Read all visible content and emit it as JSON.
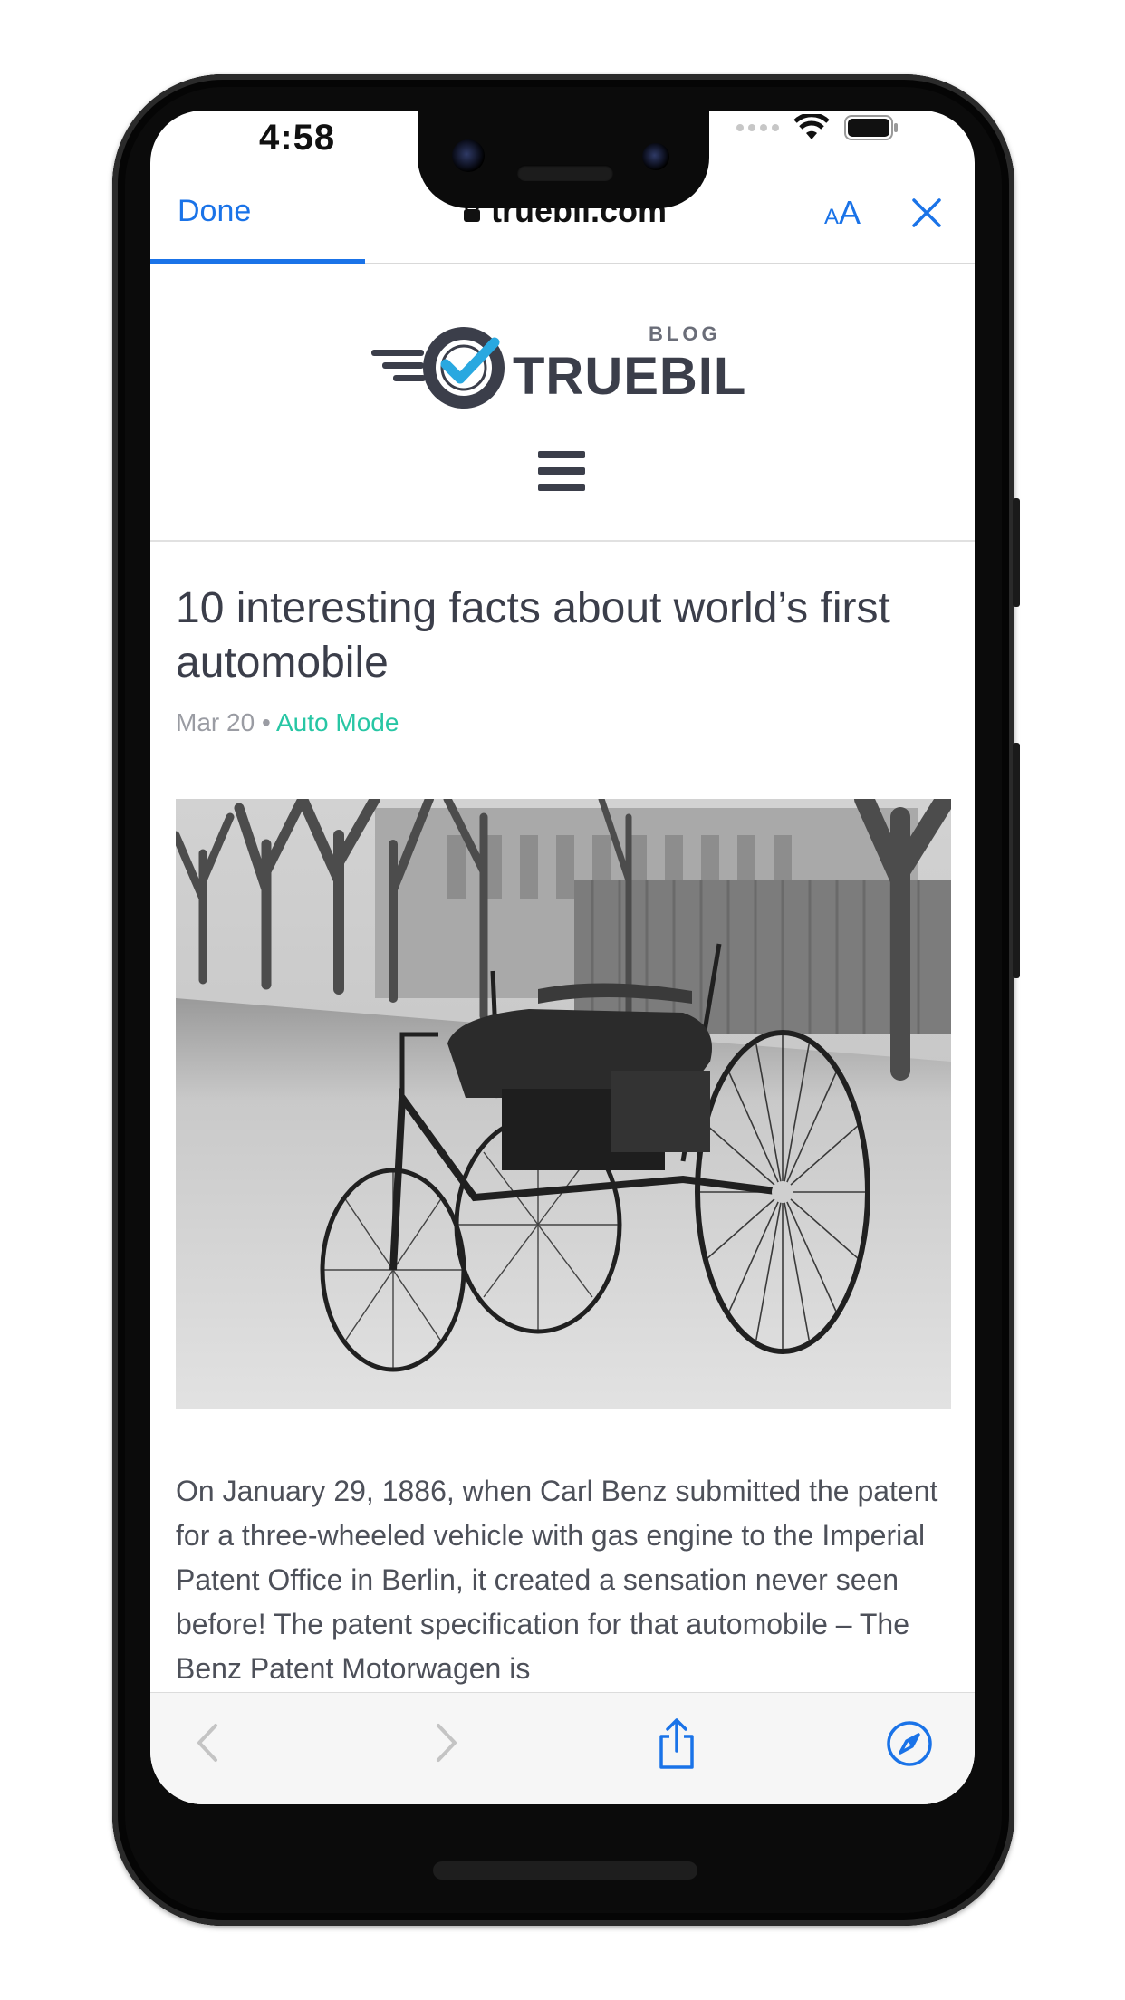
{
  "status_bar": {
    "time": "4:58"
  },
  "browser": {
    "done_label": "Done",
    "url": "truebil.com",
    "text_size_small": "A",
    "text_size_big": "A",
    "load_progress": 0.26,
    "accent_color": "#1a73e8"
  },
  "site": {
    "logo_word": "TRUEBIL",
    "logo_tag": "BLOG",
    "menu_icon": "hamburger-menu-icon"
  },
  "article": {
    "title": "10 interesting facts about world’s first automobile",
    "date": "Mar 20",
    "separator": "•",
    "category": "Auto Mode",
    "category_color": "#27c6a4",
    "image_subject": "black-and-white photo of the Benz Patent Motorwagen",
    "body": "On January 29, 1886, when Carl Benz submitted the patent for a three-wheeled vehicle with gas engine to the Imperial Patent Office in Berlin, it created a sensation never seen before! The patent specification for that automobile – The Benz Patent Motorwagen is"
  },
  "toolbar": {
    "icons": [
      "back-icon",
      "forward-icon",
      "share-icon",
      "safari-compass-icon"
    ]
  }
}
